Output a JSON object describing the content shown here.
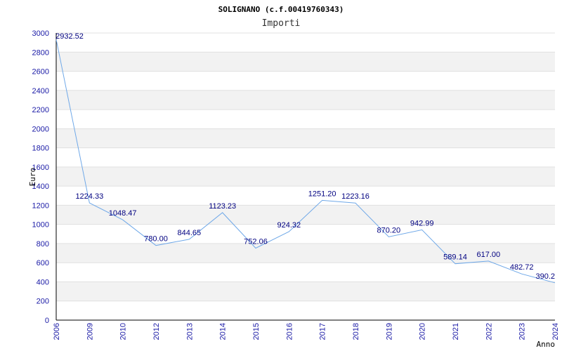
{
  "chart_data": {
    "type": "line",
    "title": "SOLIGNANO (c.f.00419760343)",
    "subtitle": "Importi",
    "ylabel": "Euro",
    "xlabel": "Anno",
    "categories": [
      "2006",
      "2009",
      "2010",
      "2012",
      "2013",
      "2014",
      "2015",
      "2016",
      "2017",
      "2018",
      "2019",
      "2020",
      "2021",
      "2022",
      "2023",
      "2024"
    ],
    "values": [
      2932.52,
      1224.33,
      1048.47,
      780.0,
      844.65,
      1123.23,
      752.06,
      924.32,
      1251.2,
      1223.16,
      870.2,
      942.99,
      589.14,
      617.0,
      482.72,
      390.2
    ],
    "data_labels": [
      "2932.52",
      "1224.33",
      "1048.47",
      "780.00",
      "844.65",
      "1123.23",
      "752.06",
      "924.32",
      "1251.20",
      "1223.16",
      "870.20",
      "942.99",
      "589.14",
      "617.00",
      "482.72",
      "390.2"
    ],
    "ylim": [
      0,
      3000
    ],
    "yticks": [
      "0",
      "200",
      "400",
      "600",
      "800",
      "1000",
      "1200",
      "1400",
      "1600",
      "1800",
      "2000",
      "2200",
      "2400",
      "2600",
      "2800",
      "3000"
    ],
    "grid": "horizontal alternating bands",
    "colors": {
      "line": "#6fa8e8",
      "band": "#f2f2f2",
      "tick_text": "#1a1aa6",
      "label_text": "#000080"
    }
  }
}
